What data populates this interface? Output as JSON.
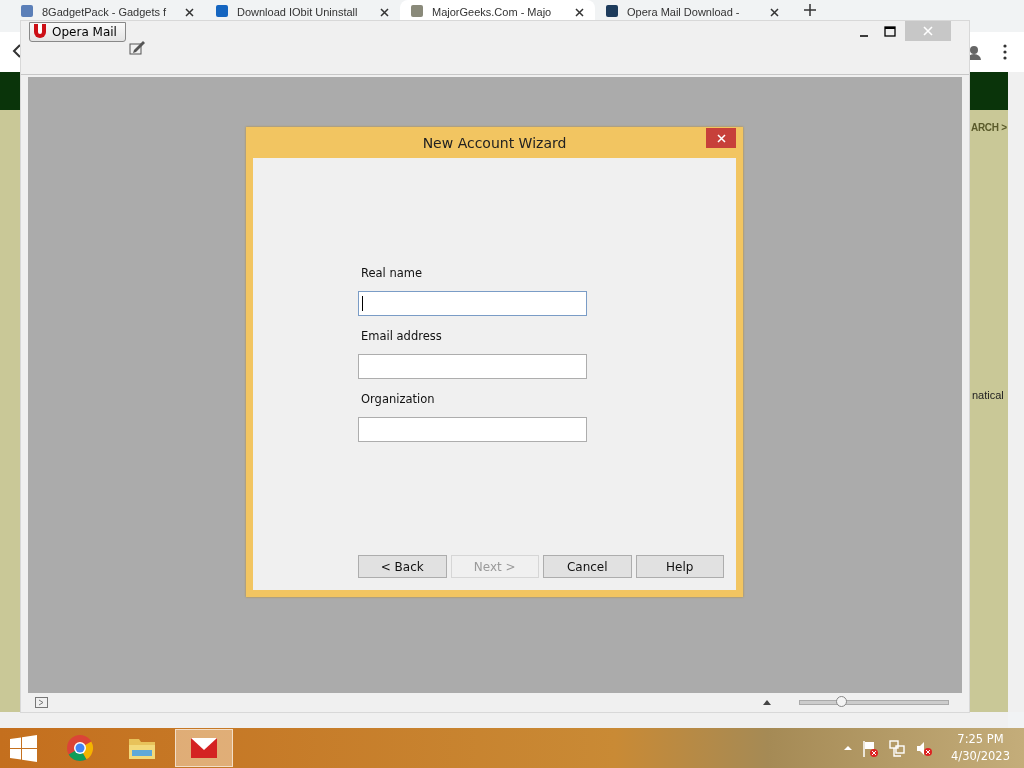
{
  "browser": {
    "tabs": [
      {
        "title": "8GadgetPack - Gadgets f",
        "selected": false
      },
      {
        "title": "Download IObit Uninstall",
        "selected": false
      },
      {
        "title": "MajorGeeks.Com - Majo",
        "selected": true
      },
      {
        "title": "Opera Mail Download - ",
        "selected": false
      }
    ],
    "page_texts": [
      "ARCH >",
      "natical"
    ]
  },
  "mail_window": {
    "app_button": "Opera Mail",
    "zoom": {
      "level": 0.28
    }
  },
  "dialog": {
    "title": "New Account Wizard",
    "fields": [
      {
        "label": "Real name",
        "focused": true
      },
      {
        "label": "Email address",
        "focused": false
      },
      {
        "label": "Organization",
        "focused": false
      }
    ],
    "buttons": [
      {
        "label": "< Back",
        "disabled": false
      },
      {
        "label": "Next >",
        "disabled": true
      },
      {
        "label": "Cancel",
        "disabled": false
      },
      {
        "label": "Help",
        "disabled": false
      }
    ]
  },
  "taskbar": {
    "apps": [
      {
        "kind": "chrome",
        "selected": false
      },
      {
        "kind": "folder",
        "selected": false
      },
      {
        "kind": "mail",
        "selected": true
      }
    ],
    "time": "7:25 PM",
    "date": "4/30/2023"
  }
}
